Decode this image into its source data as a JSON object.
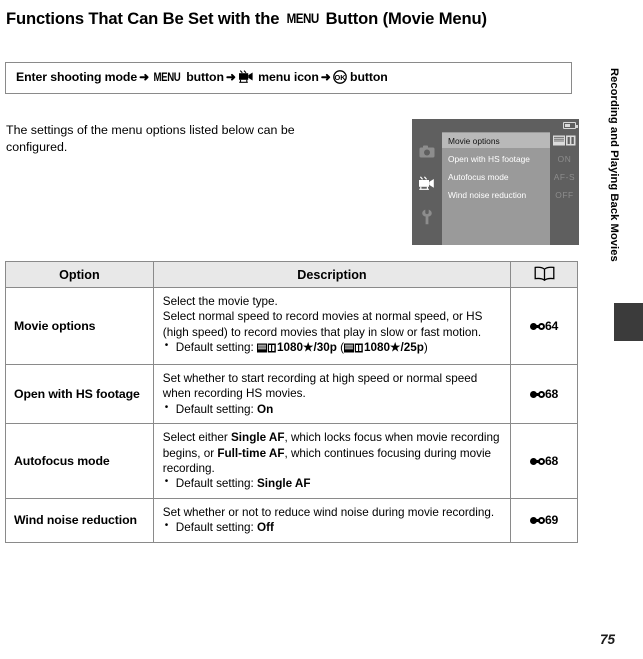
{
  "page": {
    "number": "75",
    "chapter_label": "Recording and Playing Back Movies"
  },
  "heading": {
    "before_icon": "Functions That Can Be Set with the ",
    "icon": "MENU",
    "after_icon": " Button (Movie Menu)"
  },
  "path_box": {
    "step1": "Enter shooting mode",
    "arrow": "➜",
    "menu_word": "MENU",
    "step2_suffix": " button",
    "movie_icon_name": "movie-camera-icon",
    "step3": " menu icon",
    "ok_icon_name": "ok-button-icon",
    "step4": " button"
  },
  "intro": "The settings of the menu options listed below can be configured.",
  "camera_screen": {
    "tabs": [
      {
        "name": "shooting-menu-tab",
        "icon": "camera-icon",
        "selected": false
      },
      {
        "name": "movie-menu-tab",
        "icon": "movie-camera-icon",
        "selected": true
      },
      {
        "name": "setup-menu-tab",
        "icon": "wrench-icon",
        "selected": false
      }
    ],
    "battery_icon": "battery-icon",
    "rows": [
      {
        "label": "Movie options",
        "value": "",
        "value_icon": "movie-options-icon",
        "selected": true
      },
      {
        "label": "Open with HS footage",
        "value": "ON",
        "value_icon": "",
        "selected": false
      },
      {
        "label": "Autofocus mode",
        "value": "AF-S",
        "value_icon": "",
        "selected": false
      },
      {
        "label": "Wind noise reduction",
        "value": "OFF",
        "value_icon": "",
        "selected": false
      }
    ]
  },
  "table": {
    "headers": {
      "option": "Option",
      "description": "Description",
      "reference": "book-icon"
    },
    "rows": [
      {
        "option": "Movie options",
        "desc_lines": [
          "Select the movie type.",
          "Select normal speed to record movies at normal speed, or HS (high speed) to record movies that play in slow or fast motion."
        ],
        "bullet_prefix": "Default setting: ",
        "bullet_value_a": "1080★/30p",
        "bullet_value_b": "1080★/25p",
        "bullet_has_icons": true,
        "ref_symbol": "E",
        "ref_number": "64"
      },
      {
        "option": "Open with HS footage",
        "desc_lines": [
          "Set whether to start recording at high speed or normal speed when recording HS movies."
        ],
        "bullet_prefix": "Default setting: ",
        "bullet_value_a": "On",
        "bullet_value_b": "",
        "bullet_has_icons": false,
        "ref_symbol": "E",
        "ref_number": "68"
      },
      {
        "option": "Autofocus mode",
        "desc_lines_rich": true,
        "desc_a": "Select either ",
        "desc_b": "Single AF",
        "desc_c": ", which locks focus when movie recording begins, or ",
        "desc_d": "Full-time AF",
        "desc_e": ", which continues focusing during movie recording.",
        "bullet_prefix": "Default setting: ",
        "bullet_value_a": "Single AF",
        "bullet_value_b": "",
        "bullet_has_icons": false,
        "ref_symbol": "E",
        "ref_number": "68"
      },
      {
        "option": "Wind noise reduction",
        "desc_lines": [
          "Set whether or not to reduce wind noise during movie recording."
        ],
        "bullet_prefix": "Default setting: ",
        "bullet_value_a": "Off",
        "bullet_value_b": "",
        "bullet_has_icons": false,
        "ref_symbol": "E",
        "ref_number": "69"
      }
    ]
  }
}
